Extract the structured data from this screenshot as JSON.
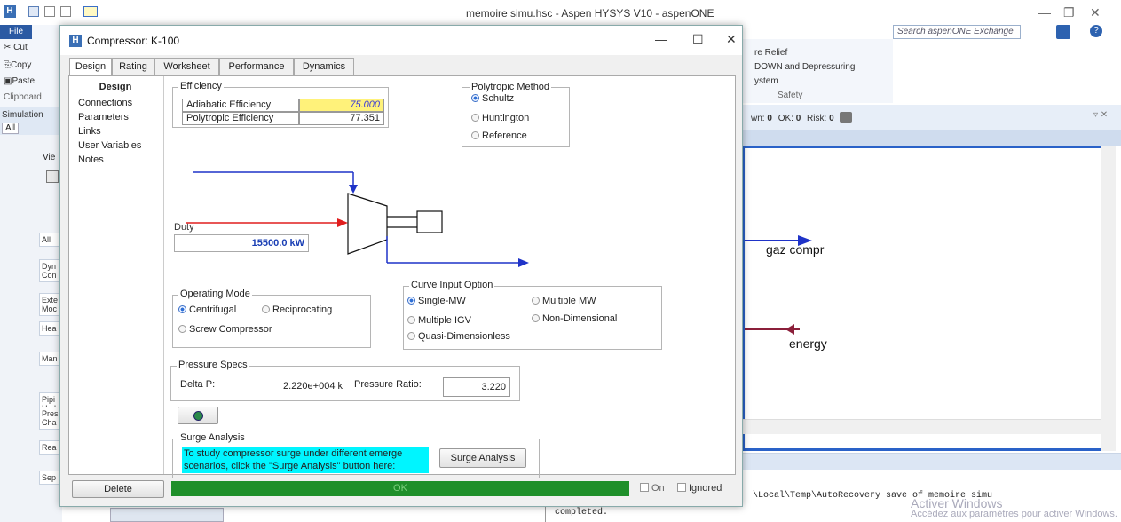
{
  "app": {
    "title": "memoire simu.hsc - Aspen HYSYS V10 - aspenONE",
    "logo_text": "H",
    "search_placeholder": "Search aspenONE Exchange"
  },
  "ribbon": {
    "file": "File",
    "cut": "Cut",
    "copy": "Copy",
    "paste": "Paste",
    "clipboard": "Clipboard",
    "pressure_relief": "re Relief",
    "blowdown": "DOWN and Depressuring",
    "system": "ystem",
    "safety": "Safety"
  },
  "simulation": {
    "label": "Simulation",
    "all_tab": "All"
  },
  "status": {
    "warn_label": "wn:",
    "warn_count": "0",
    "ok_label": "OK:",
    "ok_count": "0",
    "risk_label": "Risk:",
    "risk_count": "0"
  },
  "pfd": {
    "stream_out": "gaz compr",
    "energy_stream": "energy",
    "accent_stream": "#1f33c8",
    "accent_energy": "#8b1f3a"
  },
  "left_panel": {
    "items": [
      "All",
      "Dyn Con",
      "Exte Moc",
      "Hea",
      "Man",
      "Pipi Hyd",
      "Pres Cha",
      "Rea",
      "Sep"
    ],
    "view_label": "Vie"
  },
  "log": {
    "line1": "\\Local\\Temp\\AutoRecovery save of memoire simu",
    "line2": "completed.",
    "watermark1": "Activer Windows",
    "watermark2": "Accédez aux paramètres pour activer Windows."
  },
  "dialog": {
    "title": "Compressor: K-100",
    "tabs": [
      "Design",
      "Rating",
      "Worksheet",
      "Performance",
      "Dynamics"
    ],
    "side": {
      "header": "Design",
      "items": [
        "Connections",
        "Parameters",
        "Links",
        "User Variables",
        "Notes"
      ]
    },
    "efficiency": {
      "label": "Efficiency",
      "adiabatic_label": "Adiabatic Efficiency",
      "adiabatic_value": "75.000",
      "polytropic_label": "Polytropic Efficiency",
      "polytropic_value": "77.351"
    },
    "polytropic_method": {
      "label": "Polytropic Method",
      "options": [
        "Schultz",
        "Huntington",
        "Reference"
      ],
      "selected": "Schultz"
    },
    "duty": {
      "label": "Duty",
      "value": "15500.0 kW"
    },
    "operating_mode": {
      "label": "Operating Mode",
      "options": [
        "Centrifugal",
        "Reciprocating",
        "Screw Compressor"
      ],
      "selected": "Centrifugal"
    },
    "curve_input": {
      "label": "Curve Input Option",
      "options": [
        "Single-MW",
        "Multiple MW",
        "Multiple IGV",
        "Non-Dimensional",
        "Quasi-Dimensionless"
      ],
      "selected": "Single-MW"
    },
    "pressure": {
      "label": "Pressure Specs",
      "delta_label": "Delta P:",
      "delta_value": "2.220e+004 k",
      "ratio_label": "Pressure Ratio:",
      "ratio_value": "3.220"
    },
    "surge": {
      "label": "Surge Analysis",
      "note": "To study compressor surge under different emerge scenarios, click the \"Surge Analysis\" button here:",
      "button": "Surge Analysis"
    },
    "footer": {
      "delete": "Delete",
      "status": "OK",
      "on": "On",
      "ignored": "Ignored"
    }
  }
}
